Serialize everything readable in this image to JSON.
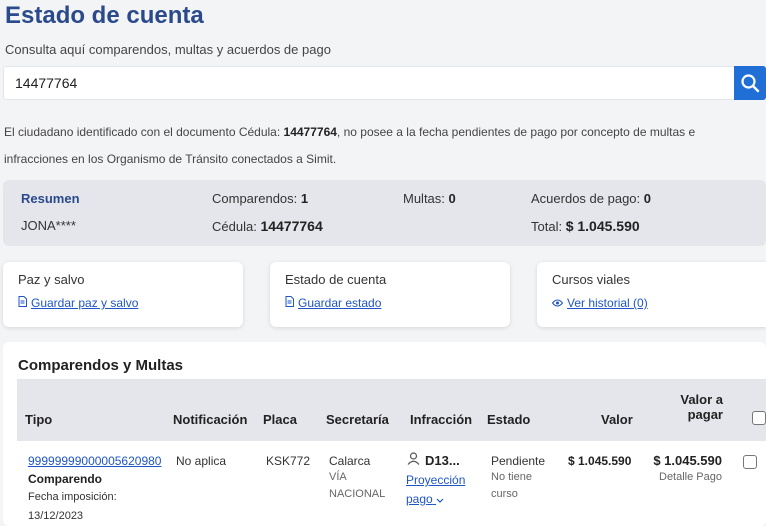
{
  "header": {
    "title": "Estado de cuenta",
    "subtitle": "Consulta aquí comparendos, multas y acuerdos de pago"
  },
  "search": {
    "value": "14477764",
    "button_icon": "search-icon"
  },
  "notice": {
    "prefix": "El ciudadano identificado con el documento Cédula:",
    "document": "14477764",
    "line1_rest": ", no posee a la fecha pendientes de pago por concepto de multas e",
    "line2": "infracciones en los Organismo de Tránsito conectados a Simit."
  },
  "summary": {
    "title": "Resumen",
    "name": "JONA****",
    "comparendos_label": "Comparendos:",
    "comparendos_value": "1",
    "multas_label": "Multas:",
    "multas_value": "0",
    "acuerdos_label": "Acuerdos de pago:",
    "acuerdos_value": "0",
    "cedula_label": "Cédula:",
    "cedula_value": "14477764",
    "total_label": "Total:",
    "total_value": "$ 1.045.590"
  },
  "cards": [
    {
      "title": "Paz y salvo",
      "link": "Guardar paz y salvo",
      "icon": "document-icon"
    },
    {
      "title": "Estado de cuenta",
      "link": "Guardar estado",
      "icon": "document-icon"
    },
    {
      "title": "Cursos viales",
      "link": "Ver historial (0)",
      "icon": "eye-icon"
    }
  ],
  "table": {
    "title": "Comparendos y Multas",
    "columns": {
      "tipo": "Tipo",
      "notificacion": "Notificación",
      "placa": "Placa",
      "secretaria": "Secretaría",
      "infraccion": "Infracción",
      "estado": "Estado",
      "valor": "Valor",
      "valor_pagar_1": "Valor a",
      "valor_pagar_2": "pagar"
    },
    "rows": [
      {
        "numero": "99999999000005620980",
        "tipo": "Comparendo",
        "fecha_label": "Fecha imposición:",
        "fecha": "13/12/2023",
        "notificacion": "No aplica",
        "placa": "KSK772",
        "secretaria": "Calarca",
        "secretaria_sub1": "VÍA",
        "secretaria_sub2": "NACIONAL",
        "infraccion": "D13...",
        "proyeccion_1": "Proyección",
        "proyeccion_2": "pago",
        "estado": "Pendiente",
        "estado_sub1": "No tiene",
        "estado_sub2": "curso",
        "valor": "$ 1.045.590",
        "valor_pagar": "$ 1.045.590",
        "detalle": "Detalle Pago"
      }
    ]
  }
}
